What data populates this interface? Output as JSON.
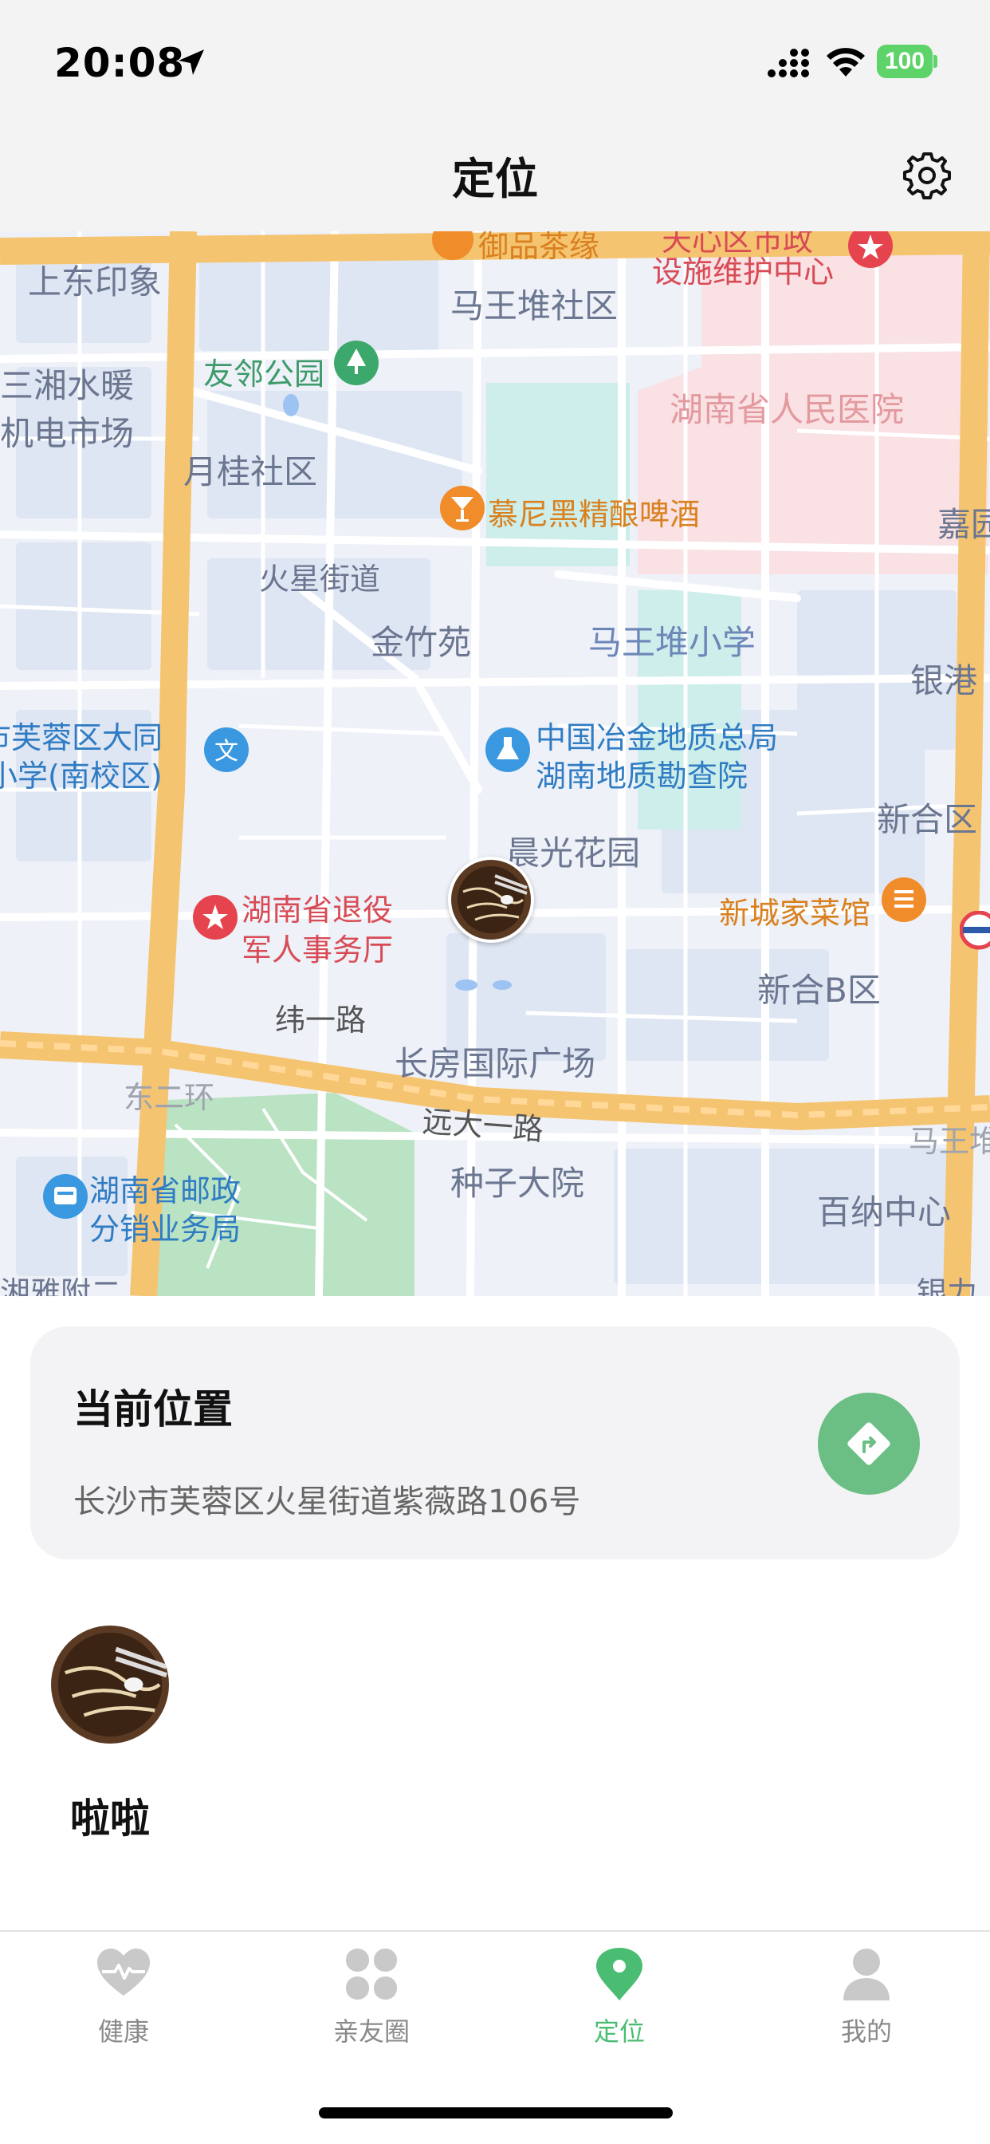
{
  "status_bar": {
    "time": "20:08",
    "battery": "100"
  },
  "header": {
    "title": "定位",
    "settings_icon": "gear-icon"
  },
  "map": {
    "labels": {
      "shangdong": "上东印象",
      "yupin": "御品茶缘",
      "tianxin": "天心区市政",
      "sheshi": "设施维护中心",
      "mawangdui": "马王堆社区",
      "sanxiang1": "三湘水暖",
      "sanxiang2": "机电市场",
      "youlin": "友邻公园",
      "hospital": "湖南省人民医院",
      "yuegui": "月桂社区",
      "munich": "慕尼黑精酿啤酒",
      "jia": "嘉园",
      "huoxing": "火星街道",
      "jinzhu": "金竹苑",
      "mwdschool": "马王堆小学",
      "yingang": "银港",
      "datong1": "长沙市芙蓉区大同",
      "datong2": "古汉城小学(南校区)",
      "yejin1": "中国冶金地质总局",
      "yejin2": "湖南地质勘查院",
      "xinhe": "新合区",
      "chenguang": "晨光花园",
      "tuiyi1": "湖南省退役",
      "tuiyi2": "军人事务厅",
      "xincheng": "新城家菜馆",
      "xinheb": "新合B区",
      "weiyi": "纬一路",
      "changfang": "长房国际广场",
      "dongerhuan": "东二环",
      "yuanda": "远大一路",
      "mawangdui2": "马王堆",
      "post1": "湖南省邮政",
      "post2": "分销业务局",
      "zhongzi": "种子大院",
      "baina": "百纳中心",
      "bottom_left": "湘雅附二",
      "bottom_right": "银力"
    }
  },
  "location_card": {
    "title": "当前位置",
    "address": "长沙市芙蓉区火星街道紫薇路106号",
    "nav_icon": "navigation-diamond-icon"
  },
  "member": {
    "name": "啦啦"
  },
  "tabs": [
    {
      "label": "健康",
      "icon": "heart-pulse-icon",
      "active": false
    },
    {
      "label": "亲友圈",
      "icon": "grid-icon",
      "active": false
    },
    {
      "label": "定位",
      "icon": "location-pin-icon",
      "active": true
    },
    {
      "label": "我的",
      "icon": "person-icon",
      "active": false
    }
  ],
  "colors": {
    "accent": "#4bbd72",
    "nav_button": "#6bbf84",
    "road_major": "#f5c470",
    "park": "#b9e3c2"
  }
}
